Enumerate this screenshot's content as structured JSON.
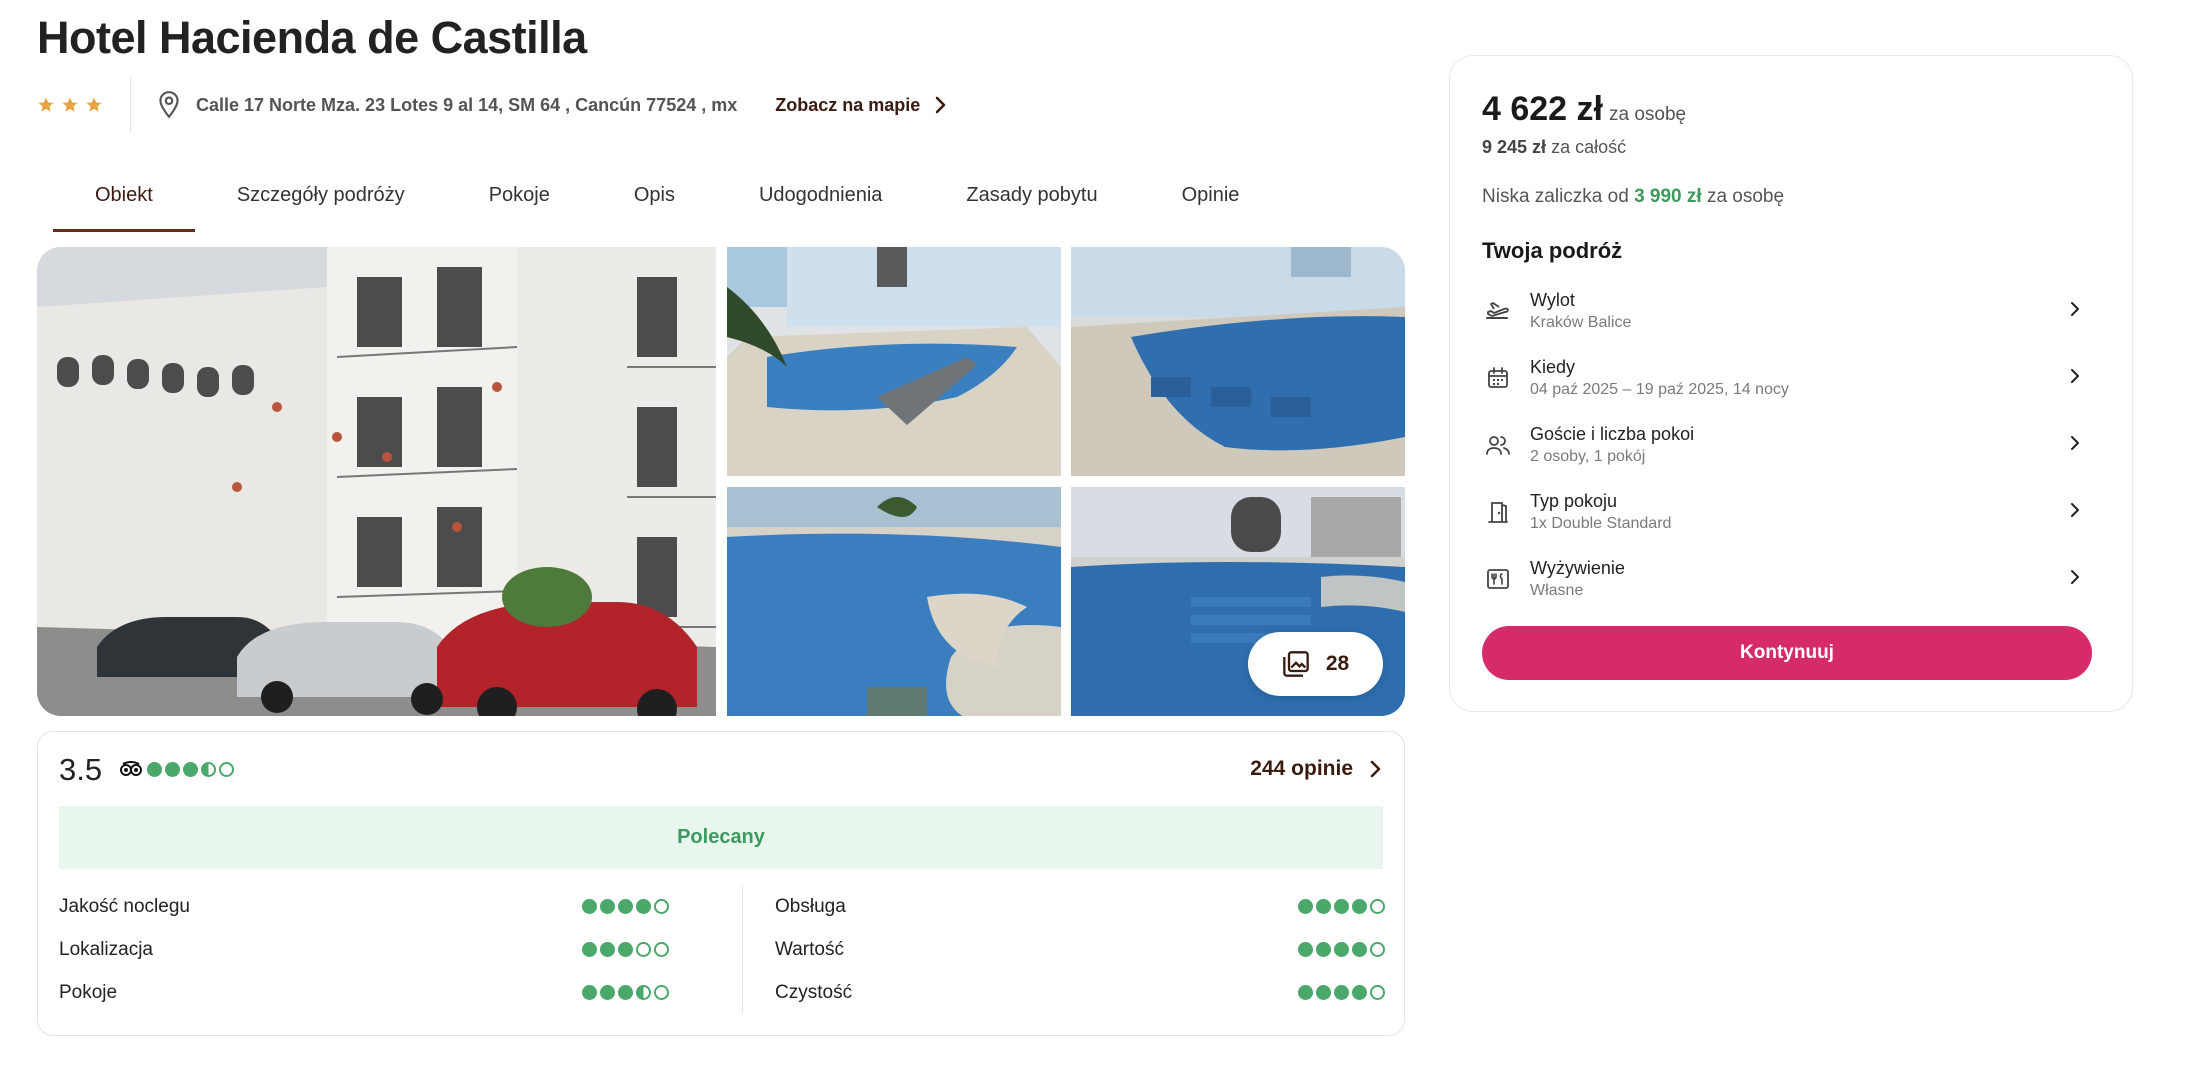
{
  "hotel": {
    "name": "Hotel Hacienda de Castilla",
    "stars": 3,
    "address": "Calle 17 Norte Mza. 23 Lotes 9 al 14, SM 64 , Cancún 77524 , mx",
    "map_link": "Zobacz na mapie"
  },
  "tabs": [
    "Obiekt",
    "Szczegóły podróży",
    "Pokoje",
    "Opis",
    "Udogodnienia",
    "Zasady pobytu",
    "Opinie"
  ],
  "active_tab": 0,
  "gallery": {
    "photo_count": "28"
  },
  "reviews": {
    "score": "3.5",
    "tripadvisor_rating": 3.5,
    "count_label": "244 opinie",
    "badge": "Polecany",
    "left_items": [
      {
        "label": "Jakość noclegu",
        "rating": 4
      },
      {
        "label": "Lokalizacja",
        "rating": 3
      },
      {
        "label": "Pokoje",
        "rating": 3.5
      }
    ],
    "right_items": [
      {
        "label": "Obsługa",
        "rating": 4
      },
      {
        "label": "Wartość",
        "rating": 4
      },
      {
        "label": "Czystość",
        "rating": 4
      }
    ]
  },
  "booking": {
    "price": "4 622 zł",
    "price_unit": "za osobę",
    "total_price": "9 245 zł",
    "total_unit": "za całość",
    "deposit_prefix": "Niska zaliczka od",
    "deposit_amount": "3 990 zł",
    "deposit_suffix": "za osobę",
    "trip_title": "Twoja podróż",
    "trip_items": [
      {
        "label": "Wylot",
        "value": "Kraków Balice",
        "icon": "plane-departure-icon"
      },
      {
        "label": "Kiedy",
        "value": "04 paź 2025 – 19 paź 2025, 14 nocy",
        "icon": "calendar-icon"
      },
      {
        "label": "Goście i liczba pokoi",
        "value": "2 osoby, 1 pokój",
        "icon": "guests-icon"
      },
      {
        "label": "Typ pokoju",
        "value": "1x Double Standard",
        "icon": "door-icon"
      },
      {
        "label": "Wyżywienie",
        "value": "Własne",
        "icon": "fork-knife-icon"
      }
    ],
    "cta": "Kontynuuj"
  },
  "colors": {
    "brand": "#d62b6b",
    "rating_green": "#4aa86b",
    "link_brown": "#3a1b10",
    "star_gold": "#e8a444"
  }
}
